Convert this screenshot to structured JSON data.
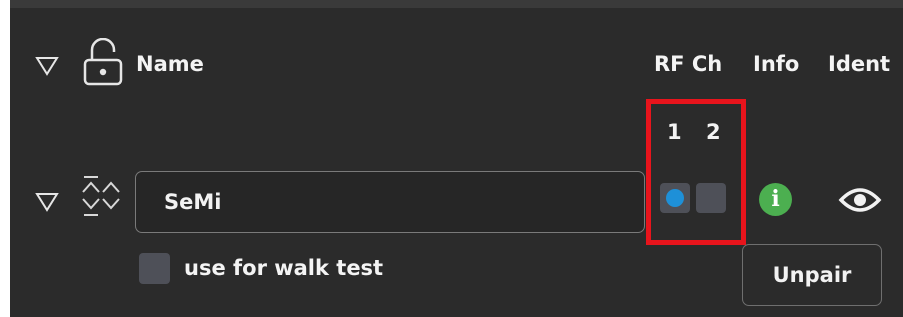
{
  "header": {
    "name_label": "Name",
    "rf_ch_label": "RF Ch",
    "info_label": "Info",
    "ident_label": "Ident"
  },
  "channels": {
    "numbers": [
      "1",
      "2"
    ]
  },
  "device": {
    "name_value": "SeMi",
    "walk_test_label": "use for walk test",
    "unpair_label": "Unpair",
    "info_glyph": "i"
  },
  "icons": {
    "header_expand": "triangle-down-icon",
    "lock": "unlocked-padlock-icon",
    "row_expand": "triangle-down-icon",
    "signal": "signal-arrows-icon",
    "info": "info-icon",
    "ident": "eye-icon"
  },
  "colors": {
    "panel_bg": "#2b2b2b",
    "highlight_border": "#e8141c",
    "channel_active": "#1e90d8",
    "info_green": "#4caf50"
  }
}
